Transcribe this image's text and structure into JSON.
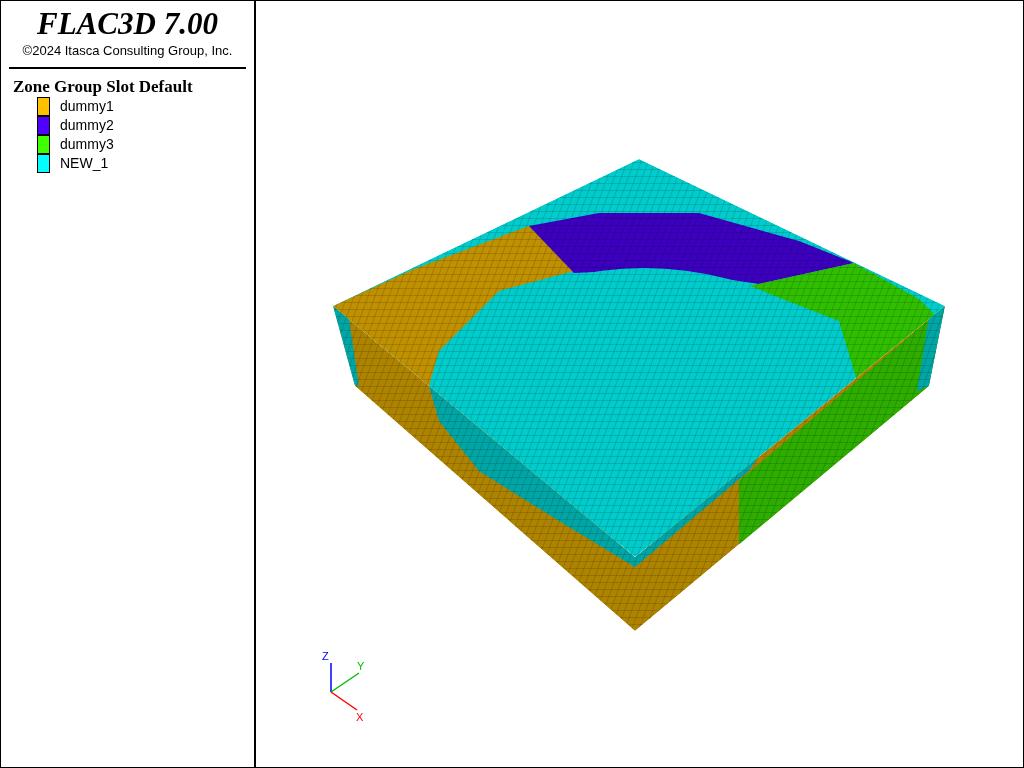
{
  "title": "FLAC3D 7.00",
  "copyright": "©2024 Itasca Consulting Group, Inc.",
  "legend": {
    "title": "Zone Group Slot Default",
    "items": [
      {
        "label": "dummy1",
        "color": "#ffc000"
      },
      {
        "label": "dummy2",
        "color": "#5000ff"
      },
      {
        "label": "dummy3",
        "color": "#40ff00"
      },
      {
        "label": "NEW_1",
        "color": "#00ffff"
      }
    ]
  },
  "axes": {
    "z": "Z",
    "y": "Y",
    "x": "X"
  }
}
